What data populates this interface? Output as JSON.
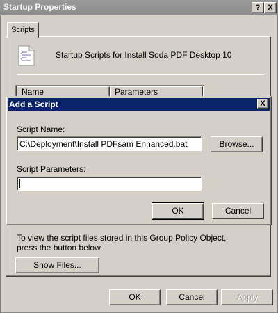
{
  "window": {
    "title": "Startup Properties",
    "help_glyph": "?",
    "close_glyph": "X"
  },
  "tabs": [
    {
      "label": "Scripts"
    }
  ],
  "panel": {
    "heading": "Startup Scripts for Install Soda PDF Desktop 10",
    "list_columns": [
      "Name",
      "Parameters"
    ],
    "info_text": "To view the script files stored in this Group Policy Object, press the button below.",
    "show_files_button": "Show Files..."
  },
  "footer": {
    "ok": "OK",
    "cancel": "Cancel",
    "apply": "Apply"
  },
  "add_script_dialog": {
    "title": "Add a Script",
    "close_glyph": "X",
    "script_name_label": "Script Name:",
    "script_name_value": "C:\\Deployment\\Install PDFsam Enhanced.bat",
    "browse_button": "Browse...",
    "script_params_label": "Script Parameters:",
    "script_params_value": "",
    "ok": "OK",
    "cancel": "Cancel"
  },
  "colors": {
    "dialog_title_active": "#0a246a",
    "window_title_inactive": "#8c8c8c",
    "face": "#d4d0c8"
  }
}
